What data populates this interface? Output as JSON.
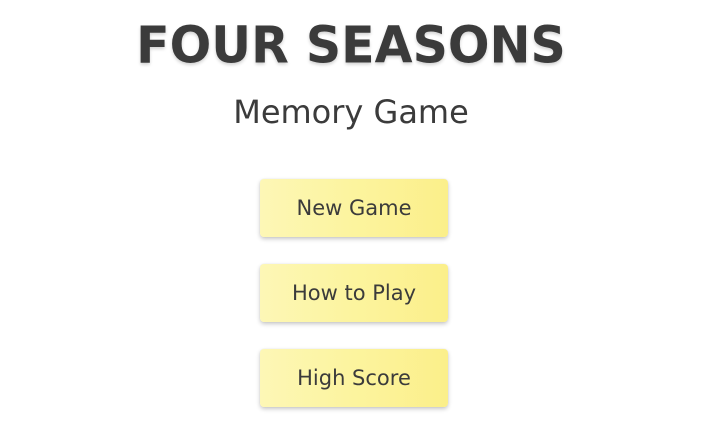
{
  "title": "FOUR SEASONS",
  "subtitle": "Memory Game",
  "menu": {
    "buttons": [
      {
        "label": "New Game"
      },
      {
        "label": "How to Play"
      },
      {
        "label": "High Score"
      }
    ]
  },
  "colors": {
    "background": "#ffffff",
    "text": "#3b3b3b",
    "button_fill_start": "#fdf7b6",
    "button_fill_end": "#fbef8a"
  }
}
